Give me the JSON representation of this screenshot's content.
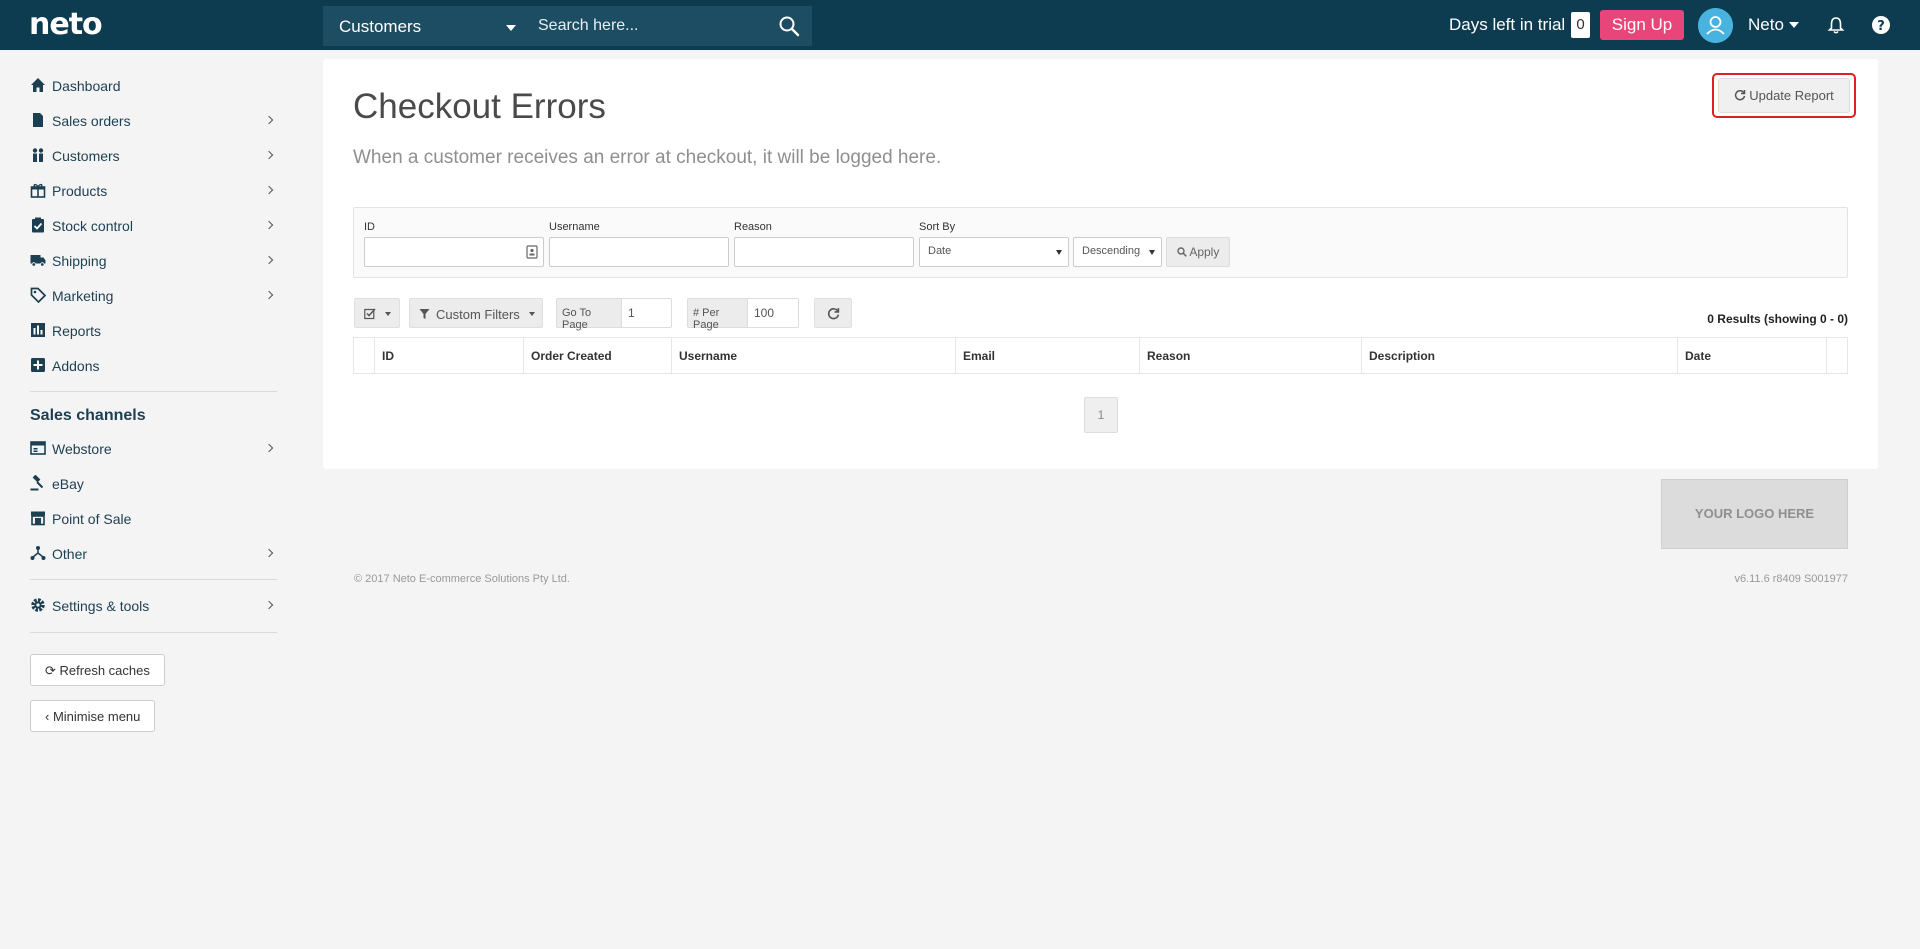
{
  "topbar": {
    "logo": "neto",
    "search_scope": "Customers",
    "search_placeholder": "Search here...",
    "trial_label": "Days left in trial",
    "trial_days": "0",
    "signup_label": "Sign Up",
    "user_name": "Neto"
  },
  "sidebar": {
    "items": [
      {
        "label": "Dashboard",
        "icon": "home-icon"
      },
      {
        "label": "Sales orders",
        "icon": "document-icon"
      },
      {
        "label": "Customers",
        "icon": "users-icon"
      },
      {
        "label": "Products",
        "icon": "gift-icon"
      },
      {
        "label": "Stock control",
        "icon": "clipboard-icon"
      },
      {
        "label": "Shipping",
        "icon": "truck-icon"
      },
      {
        "label": "Marketing",
        "icon": "tag-icon"
      },
      {
        "label": "Reports",
        "icon": "bar-chart-icon"
      },
      {
        "label": "Addons",
        "icon": "plus-square-icon"
      }
    ],
    "channels_heading": "Sales channels",
    "channels": [
      {
        "label": "Webstore",
        "icon": "window-icon"
      },
      {
        "label": "eBay",
        "icon": "gavel-icon"
      },
      {
        "label": "Point of Sale",
        "icon": "store-icon"
      },
      {
        "label": "Other",
        "icon": "network-icon"
      }
    ],
    "settings_label": "Settings & tools",
    "refresh_label": "Refresh caches",
    "minimise_label": "Minimise menu"
  },
  "page": {
    "title": "Checkout Errors",
    "subtitle": "When a customer receives an error at checkout, it will be logged here.",
    "update_label": "Update Report"
  },
  "filters": {
    "id_label": "ID",
    "username_label": "Username",
    "reason_label": "Reason",
    "sortby_label": "Sort By",
    "sort_field": "Date",
    "sort_order": "Descending",
    "apply_label": "Apply"
  },
  "toolbar": {
    "custom_filters": "Custom Filters",
    "goto_label": "Go To Page",
    "goto_value": "1",
    "perpage_label": "# Per Page",
    "perpage_value": "100",
    "results": "0 Results (showing 0 - 0)"
  },
  "table": {
    "columns": [
      "ID",
      "Order Created",
      "Username",
      "Email",
      "Reason",
      "Description",
      "Date"
    ]
  },
  "pagination": {
    "current": "1"
  },
  "footer": {
    "logo_placeholder": "YOUR LOGO HERE",
    "copyright": "© 2017 Neto E-commerce Solutions Pty Ltd.",
    "version": "v6.11.6 r8409 S001977"
  },
  "colors": {
    "topbar": "#0d3b4f",
    "signup": "#e8457a",
    "avatar": "#49b3e0",
    "highlight": "#e02020"
  }
}
